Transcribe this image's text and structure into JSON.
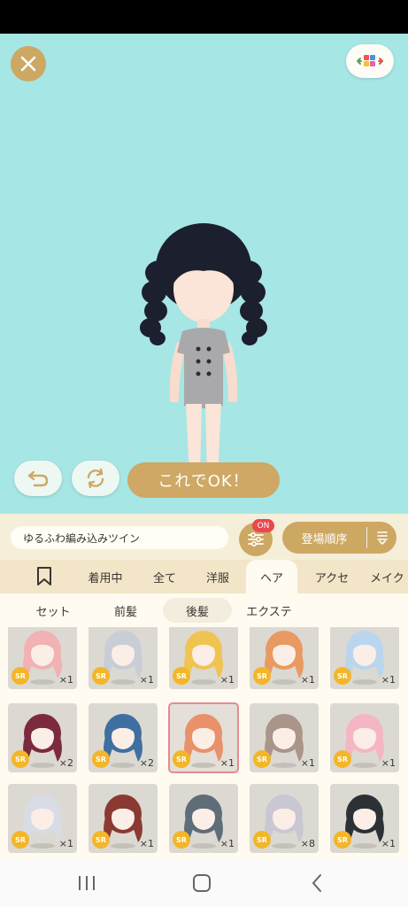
{
  "stage": {
    "bg_color": "#a6e6e4",
    "ok_label": "これでOK！"
  },
  "filter": {
    "search_text": "ゆるふわ編み込みツイン",
    "settings_badge": "ON",
    "sort_label": "登場順序"
  },
  "tabs": [
    {
      "label": "着用中"
    },
    {
      "label": "全て"
    },
    {
      "label": "洋服"
    },
    {
      "label": "ヘア",
      "active": true
    },
    {
      "label": "アクセ"
    },
    {
      "label": "メイク"
    }
  ],
  "subtabs": [
    {
      "label": "セット"
    },
    {
      "label": "前髪"
    },
    {
      "label": "後髪",
      "active": true
    },
    {
      "label": "エクステ"
    }
  ],
  "items": [
    {
      "rarity": "SR",
      "count": "×1",
      "hair": "#f2b1b2"
    },
    {
      "rarity": "SR",
      "count": "×1",
      "hair": "#c9cdd6"
    },
    {
      "rarity": "SR",
      "count": "×1",
      "hair": "#f0c450"
    },
    {
      "rarity": "SR",
      "count": "×1",
      "hair": "#e89a62"
    },
    {
      "rarity": "SR",
      "count": "×1",
      "hair": "#b9d6ee"
    },
    {
      "rarity": "SR",
      "count": "×2",
      "hair": "#7c2a3e"
    },
    {
      "rarity": "SR",
      "count": "×2",
      "hair": "#3f6fa0"
    },
    {
      "rarity": "SR",
      "count": "×1",
      "hair": "#e8916a",
      "selected": true
    },
    {
      "rarity": "SR",
      "count": "×1",
      "hair": "#a9958a"
    },
    {
      "rarity": "SR",
      "count": "×1",
      "hair": "#f4b6c3"
    },
    {
      "rarity": "SR",
      "count": "×1",
      "hair": "#d8dce4"
    },
    {
      "rarity": "SR",
      "count": "×1",
      "hair": "#8a3a32"
    },
    {
      "rarity": "SR",
      "count": "×1",
      "hair": "#5e6d78"
    },
    {
      "rarity": "SR",
      "count": "×8",
      "hair": "#c9c8d2"
    },
    {
      "rarity": "SR",
      "count": "×1",
      "hair": "#2b3135"
    }
  ]
}
